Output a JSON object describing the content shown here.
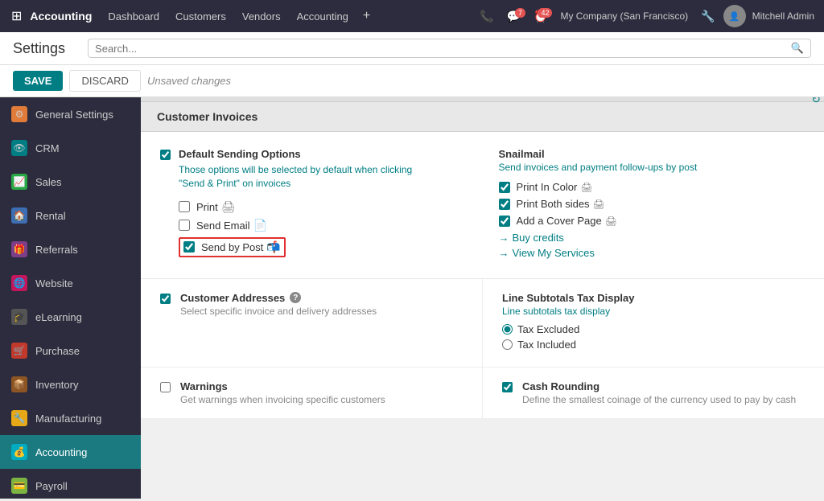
{
  "topnav": {
    "app_name": "Accounting",
    "nav_links": [
      "Dashboard",
      "Customers",
      "Vendors",
      "Accounting"
    ],
    "badge_chat": "7",
    "badge_clock": "42",
    "company": "My Company (San Francisco)",
    "user": "Mitchell Admin"
  },
  "subheader": {
    "title": "Settings",
    "search_placeholder": "Search..."
  },
  "toolbar": {
    "save": "SAVE",
    "discard": "DISCARD",
    "unsaved": "Unsaved changes"
  },
  "sidebar": {
    "items": [
      {
        "label": "General Settings",
        "icon": "⚙",
        "color": "orange",
        "active": false
      },
      {
        "label": "CRM",
        "icon": "👁",
        "color": "teal",
        "active": false
      },
      {
        "label": "Sales",
        "icon": "📈",
        "color": "green",
        "active": false
      },
      {
        "label": "Rental",
        "icon": "🏠",
        "color": "blue",
        "active": false
      },
      {
        "label": "Referrals",
        "icon": "🎁",
        "color": "purple",
        "active": false
      },
      {
        "label": "Website",
        "icon": "🌐",
        "color": "pink",
        "active": false
      },
      {
        "label": "eLearning",
        "icon": "🎓",
        "color": "dark",
        "active": false
      },
      {
        "label": "Purchase",
        "icon": "🛒",
        "color": "red",
        "active": false
      },
      {
        "label": "Inventory",
        "icon": "📦",
        "color": "brown",
        "active": false
      },
      {
        "label": "Manufacturing",
        "icon": "🔧",
        "color": "yellow",
        "active": false
      },
      {
        "label": "Accounting",
        "icon": "💰",
        "color": "cyan",
        "active": true
      },
      {
        "label": "Payroll",
        "icon": "💳",
        "color": "lime",
        "active": false
      }
    ]
  },
  "content": {
    "section_title": "Customer Invoices",
    "default_sending": {
      "title": "Default Sending Options",
      "desc_line1": "Those options will be selected by default when clicking",
      "desc_line2": "\"Send & Print\" on invoices",
      "print_label": "Print",
      "print_checked": false,
      "send_email_label": "Send Email",
      "send_email_checked": false,
      "send_by_post_label": "Send by Post",
      "send_by_post_checked": true
    },
    "snailmail": {
      "title": "Snailmail",
      "desc": "Send invoices and payment follow-ups by post",
      "print_color_label": "Print In Color",
      "print_color_checked": true,
      "print_both_label": "Print Both sides",
      "print_both_checked": true,
      "cover_page_label": "Add a Cover Page",
      "cover_page_checked": true,
      "buy_credits": "Buy credits",
      "view_services": "View My Services"
    },
    "customer_addresses": {
      "title": "Customer Addresses",
      "help": "?",
      "desc": "Select specific invoice and delivery addresses",
      "checked": true
    },
    "line_subtotals": {
      "title": "Line Subtotals Tax Display",
      "link": "Line subtotals tax display",
      "tax_excluded": "Tax Excluded",
      "tax_excluded_selected": true,
      "tax_included": "Tax Included",
      "tax_included_selected": false
    },
    "warnings": {
      "title": "Warnings",
      "desc": "Get warnings when invoicing specific customers",
      "checked": false
    },
    "cash_rounding": {
      "title": "Cash Rounding",
      "desc": "Define the smallest coinage of the currency used to pay by cash",
      "checked": true
    }
  }
}
